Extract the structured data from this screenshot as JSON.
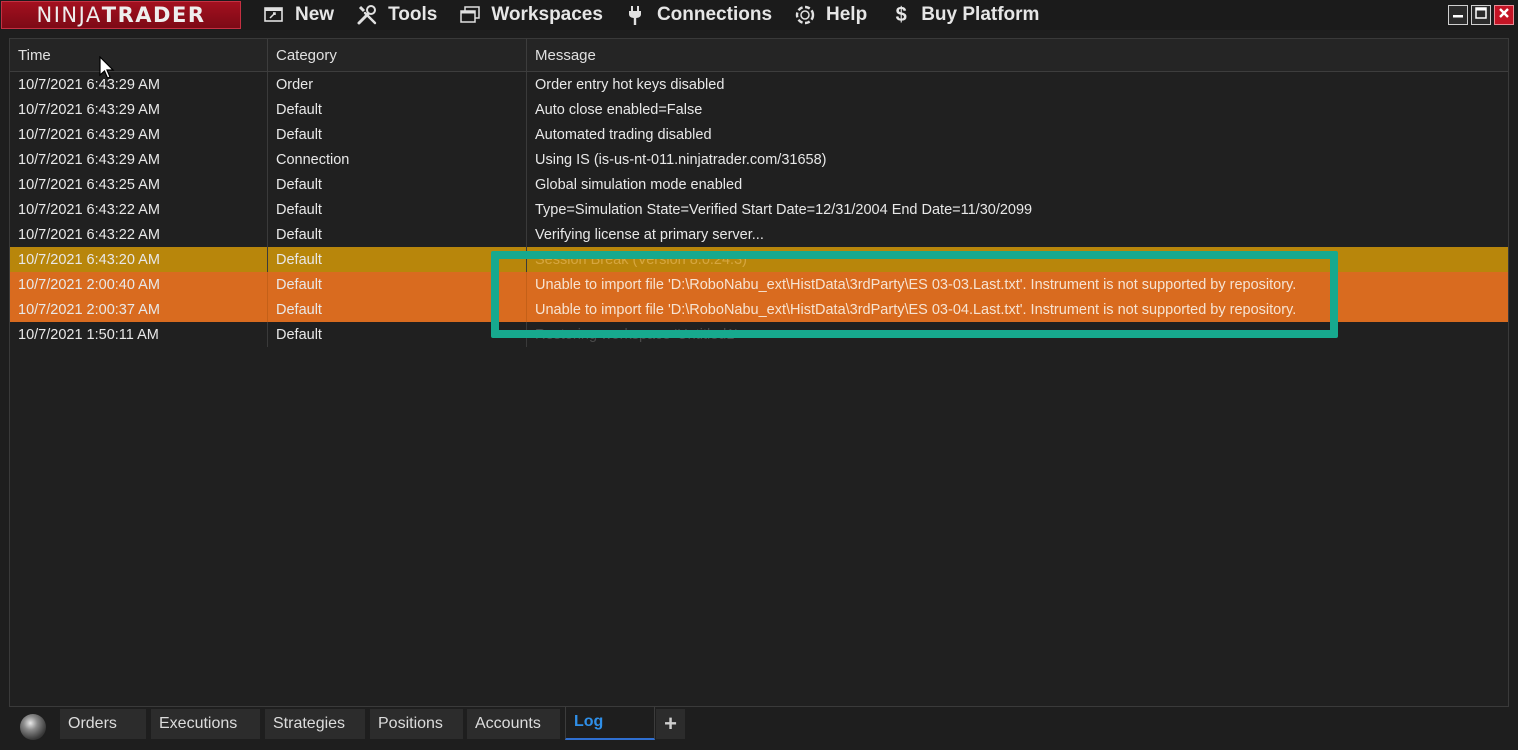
{
  "logo": {
    "ninja": "NINJA",
    "trader": "TRADER"
  },
  "menu": [
    {
      "label": "New",
      "icon": "new-window-icon"
    },
    {
      "label": "Tools",
      "icon": "tools-icon"
    },
    {
      "label": "Workspaces",
      "icon": "workspaces-icon"
    },
    {
      "label": "Connections",
      "icon": "plug-icon"
    },
    {
      "label": "Help",
      "icon": "help-lifebuoy-icon"
    },
    {
      "label": "Buy Platform",
      "icon": "dollar-icon"
    }
  ],
  "window_controls": [
    "minimize-icon",
    "maximize-icon",
    "close-icon"
  ],
  "grid": {
    "columns": {
      "time": "Time",
      "category": "Category",
      "message": "Message"
    },
    "rows": [
      {
        "time": "10/7/2021 6:43:29 AM",
        "category": "Order",
        "message": "Order entry hot keys disabled",
        "style": "normal"
      },
      {
        "time": "10/7/2021 6:43:29 AM",
        "category": "Default",
        "message": "Auto close enabled=False",
        "style": "normal"
      },
      {
        "time": "10/7/2021 6:43:29 AM",
        "category": "Default",
        "message": "Automated trading disabled",
        "style": "normal"
      },
      {
        "time": "10/7/2021 6:43:29 AM",
        "category": "Connection",
        "message": "Using IS (is-us-nt-011.ninjatrader.com/31658)",
        "style": "normal"
      },
      {
        "time": "10/7/2021 6:43:25 AM",
        "category": "Default",
        "message": "Global simulation mode enabled",
        "style": "normal"
      },
      {
        "time": "10/7/2021 6:43:22 AM",
        "category": "Default",
        "message": "Type=Simulation State=Verified Start Date=12/31/2004 End Date=11/30/2099",
        "style": "normal"
      },
      {
        "time": "10/7/2021 6:43:22 AM",
        "category": "Default",
        "message": "Verifying license at primary server...",
        "style": "normal"
      },
      {
        "time": "10/7/2021 6:43:20 AM",
        "category": "Default",
        "message": "Session Break (Version 8.0.24.3)",
        "style": "session"
      },
      {
        "time": "10/7/2021 2:00:40 AM",
        "category": "Default",
        "message": "Unable to import file 'D:\\RoboNabu_ext\\HistData\\3rdParty\\ES 03-03.Last.txt'. Instrument is not supported by repository.",
        "style": "error"
      },
      {
        "time": "10/7/2021 2:00:37 AM",
        "category": "Default",
        "message": "Unable to import file 'D:\\RoboNabu_ext\\HistData\\3rdParty\\ES 03-04.Last.txt'. Instrument is not supported by repository.",
        "style": "error"
      },
      {
        "time": "10/7/2021 1:50:11 AM",
        "category": "Default",
        "message": "Restoring workspace 'Untitled1'",
        "style": "restore"
      }
    ]
  },
  "tabs": [
    {
      "label": "Orders",
      "active": false
    },
    {
      "label": "Executions",
      "active": false
    },
    {
      "label": "Strategies",
      "active": false
    },
    {
      "label": "Positions",
      "active": false
    },
    {
      "label": "Accounts",
      "active": false
    },
    {
      "label": "Log",
      "active": true
    }
  ],
  "add_tab_label": "+",
  "colors": {
    "session_row": "#b8860b",
    "error_row": "#d96b1f",
    "highlight": "#17a98e",
    "active_tab": "#2f8fe8",
    "logo": "#a3101f"
  }
}
